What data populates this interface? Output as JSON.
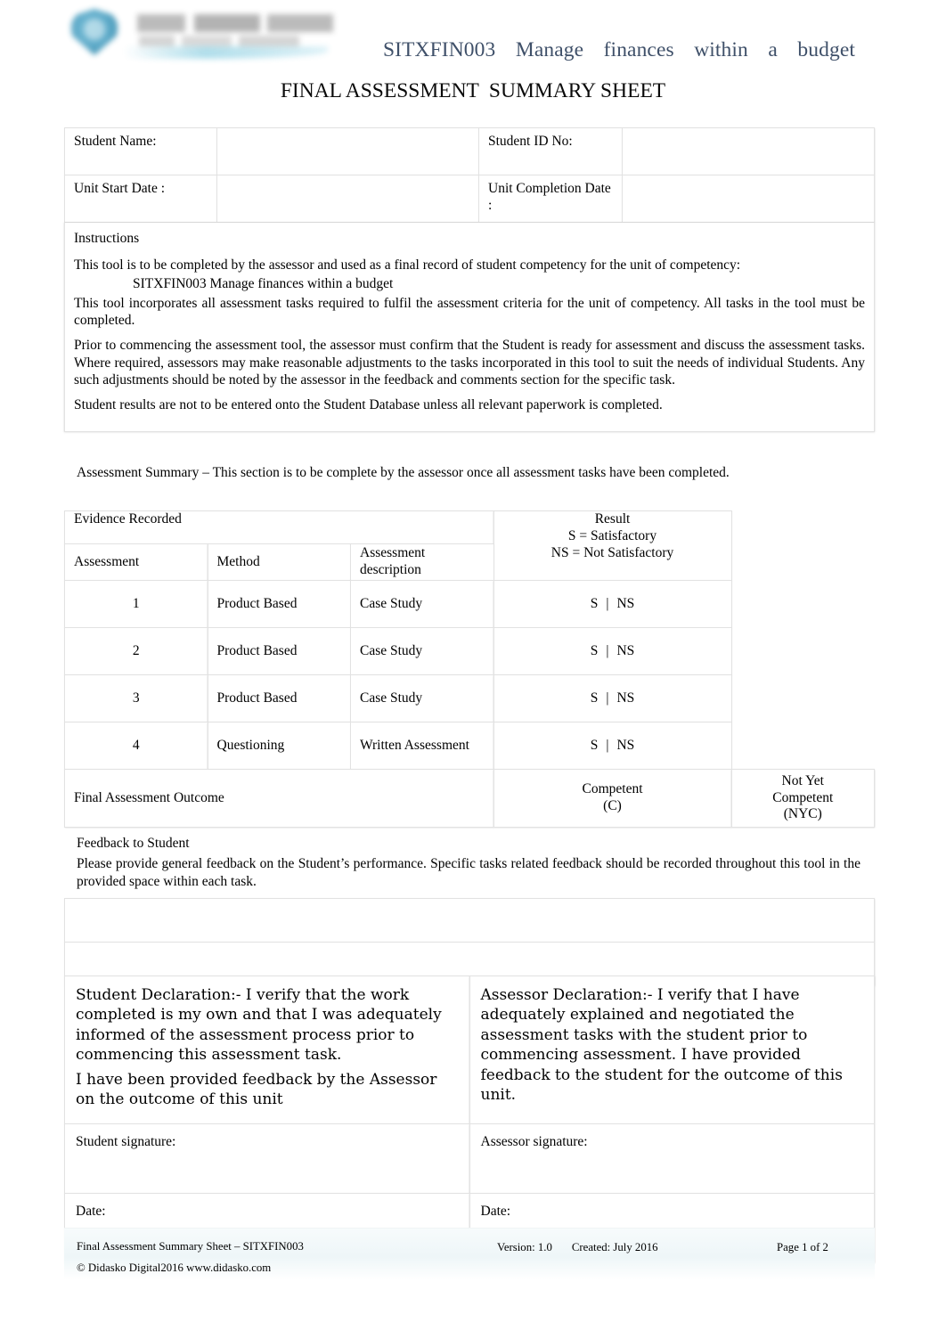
{
  "header": {
    "logo_alt": "Didasko Digital logo",
    "unit_title": "SITXFIN003  Manage   finances   within  a  budget",
    "sheet_title_part1": "FINAL ASSESSMENT",
    "sheet_title_part2": "SUMMARY SHEET"
  },
  "student_info": {
    "student_name_label": "Student  Name:",
    "student_name_value": "",
    "student_id_label": "Student  ID No:",
    "student_id_value": "",
    "unit_start_date_label": "Unit Start  Date  :",
    "unit_start_date_value": "",
    "unit_completion_date_label": "Unit Completion Date  :",
    "unit_completion_date_value": ""
  },
  "instructions": {
    "heading": "Instructions",
    "para1": "This  tool  is to  be  completed   by the  assessor    and  used  as a  final record  of student    competency    for the  unit  of competency:",
    "unit_code_line": "SITXFIN003   Manage   finances   within a  budget",
    "para2": "This  tool incorporates    all assessment    tasks  required  to fulfil the assessment    criteria  for the  unit of competency.    All tasks  in the  tool  must  be  completed.",
    "para3": "Prior to commencing   the assessment    tool, the assessor    must  confirm  that  the  Student   is ready  for assessment     and discuss  the assessment    tasks. Where  required,  assessors    may make reasonable    adjustments   to the tasks incorporated   in this tool to suit the  needs   of individual  Students.   Any  such  adjustments    should  be  noted  by the assessor    in the  feedback   and  comments    section  for the  specific   task.",
    "para4": "Student  results  are not to be entered   onto  the Student   Database    unless   all relevant   paperwork   is completed."
  },
  "assessment_summary_note": "Assessment      Summary   – This section  is to be  complete  by the  assessor    once  all assessment     tasks  have  been completed.",
  "evidence_table": {
    "section_title": "Evidence    Recorded",
    "result_header": {
      "line1": "Result",
      "line2": "S  = Satisfactory",
      "line3": "NS  = Not  Satisfactory"
    },
    "columns": [
      "Assessment",
      "Method",
      "Assessment        description"
    ],
    "rows": [
      {
        "no": "1",
        "method": "Product  Based",
        "description": "Case   Study",
        "result_s": "S",
        "result_sep": "|",
        "result_ns": "NS"
      },
      {
        "no": "2",
        "method": "Product  Based",
        "description": "Case   Study",
        "result_s": "S",
        "result_sep": "|",
        "result_ns": "NS"
      },
      {
        "no": "3",
        "method": "Product  Based",
        "description": "Case   Study",
        "result_s": "S",
        "result_sep": "|",
        "result_ns": "NS"
      },
      {
        "no": "4",
        "method": "Questioning",
        "description": "Written  Assessment",
        "result_s": "S",
        "result_sep": "|",
        "result_ns": "NS"
      }
    ],
    "outcome": {
      "label": "Final  Assessment       Outcome",
      "competent_line1": "Competent",
      "competent_line2": "(C)",
      "nyc_line1": "Not  Yet",
      "nyc_line2": "Competent",
      "nyc_line3": "(NYC)"
    }
  },
  "feedback": {
    "heading": "Feedback     to Student",
    "instruction": "Please   provide  general   feedback   on the  Student’s   performance.    Specific  tasks  related  feedback   should  be recorded   throughout   this tool in the  provided   space   within each  task.",
    "row1_value": "",
    "row2_value": ""
  },
  "declarations": {
    "student": {
      "body_line1": "Student   Declaration:-   I verify that  the  work completed   is my own and  that  I was adequately  informed    of the  assessment process   prior to        commencing   this assessment     task.",
      "body_line2": "I have  been  provided   feedback   by the Assessor  on   the outcome   of this unit",
      "signature_label": "Student  signature:",
      "signature_value": "",
      "date_label": "Date:",
      "date_value": ""
    },
    "assessor": {
      "body_line1": "Assessor      Declaration:-    I verify that  I have adequately   explained   and  negotiated   the assessment     tasks  with the  student   prior to commencing   assessment.    I have  provided feedback   to the student   for the  outcome   of this  unit.",
      "signature_label": "Assessor    signature:",
      "signature_value": "",
      "date_label": "Date:",
      "date_value": ""
    }
  },
  "footer": {
    "doc_title": "Final  Assessment    Summary   Sheet   – SITXFIN003",
    "copyright": "© Didasko  Digital2016  www.didasko.com",
    "version": "Version:   1.0",
    "created": "Created:   July  2016",
    "page": "Page   1  of 2"
  }
}
